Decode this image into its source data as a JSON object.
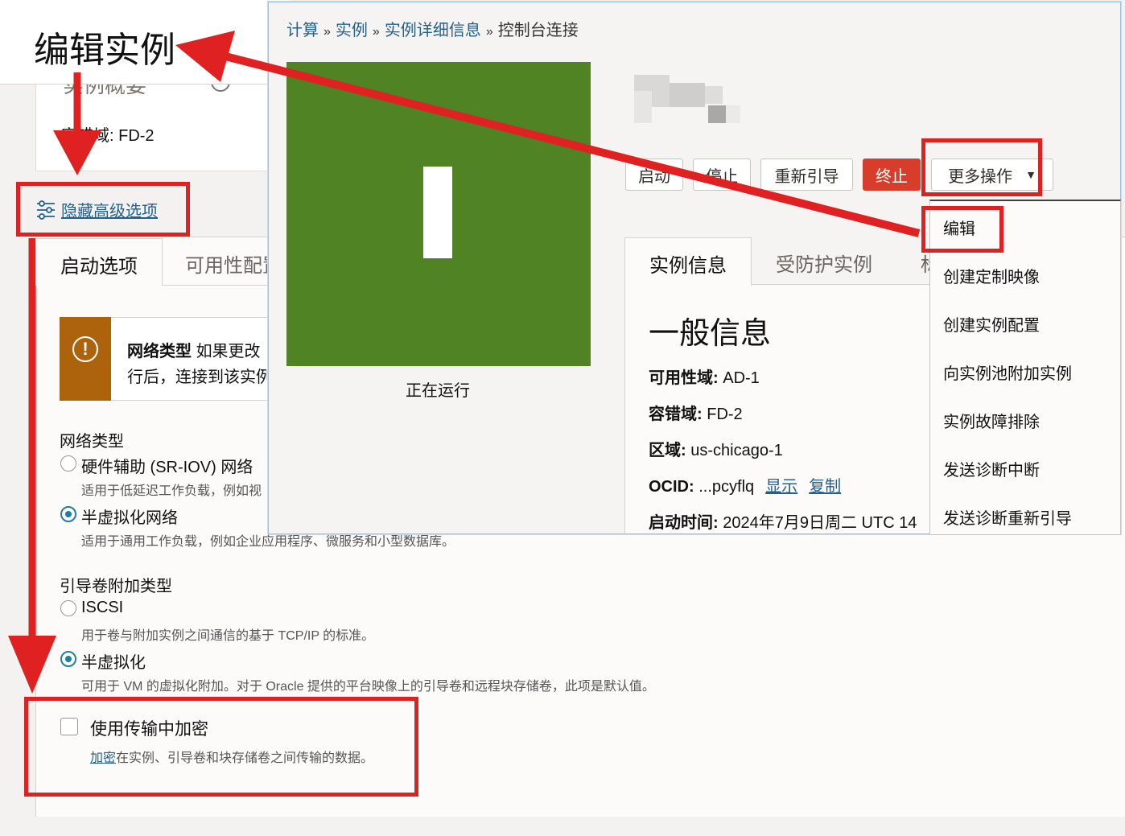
{
  "edit_page": {
    "title": "编辑实例",
    "fault_domain": "容错域: FD-2",
    "summary_heading_cut": "实例概要",
    "advanced_link": "隐藏高级选项",
    "tabs": [
      "启动选项",
      "可用性配置"
    ],
    "alert": {
      "bold": "网络类型",
      "line1": "如果更改",
      "line2": "行后，连接到该实例"
    },
    "network_type": {
      "label": "网络类型",
      "options": [
        {
          "label": "硬件辅助 (SR-IOV) 网络",
          "desc": "适用于低延迟工作负载，例如视",
          "selected": false
        },
        {
          "label": "半虚拟化网络",
          "desc": "适用于通用工作负载，例如企业应用程序、微服务和小型数据库。",
          "selected": true
        }
      ]
    },
    "boot_volume": {
      "label": "引导卷附加类型",
      "options": [
        {
          "label": "ISCSI",
          "desc": "用于卷与附加实例之间通信的基于 TCP/IP 的标准。",
          "selected": false
        },
        {
          "label": "半虚拟化",
          "desc": "可用于 VM 的虚拟化附加。对于 Oracle 提供的平台映像上的引导卷和远程块存储卷，此项是默认值。",
          "selected": true
        }
      ]
    },
    "encryption": {
      "label": "使用传输中加密",
      "link": "加密",
      "desc": "在实例、引导卷和块存储卷之间传输的数据。",
      "checked": false
    }
  },
  "instance_page": {
    "breadcrumb": {
      "items": [
        "计算",
        "实例",
        "实例详细信息"
      ],
      "separator": "»",
      "current": "控制台连接"
    },
    "tile_color": "#4f8324",
    "status": "正在运行",
    "buttons": {
      "start": "启动",
      "stop": "停止",
      "reboot": "重新引导",
      "terminate": "终止",
      "more": "更多操作"
    },
    "tabs": [
      "实例信息",
      "受防护实例",
      "标记"
    ],
    "general": {
      "title": "一般信息",
      "rows": [
        {
          "key": "可用性域:",
          "value": "AD-1"
        },
        {
          "key": "容错域:",
          "value": "FD-2"
        },
        {
          "key": "区域:",
          "value": "us-chicago-1"
        },
        {
          "key": "OCID:",
          "value": "...pcyflq"
        },
        {
          "key": "启动时间:",
          "value": "2024年7月9日周二 UTC 14"
        }
      ],
      "ocid_show": "显示",
      "ocid_copy": "复制"
    },
    "more_menu": [
      "编辑",
      "创建定制映像",
      "创建实例配置",
      "向实例池附加实例",
      "实例故障排除",
      "发送诊断中断",
      "发送诊断重新引导"
    ]
  },
  "colors": {
    "annotation_red": "#e02121",
    "link_blue": "#22618c",
    "terminate_red": "#d73d2a",
    "alert_brown": "#ac630c"
  }
}
